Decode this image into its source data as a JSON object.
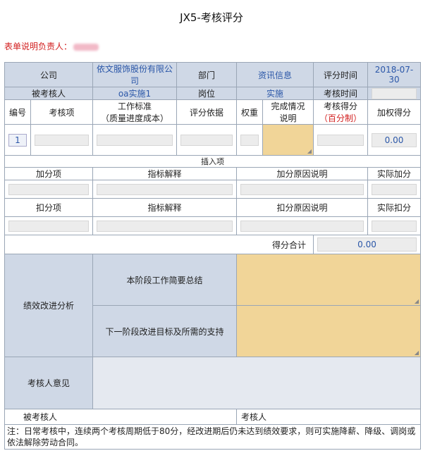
{
  "page": {
    "title": "JX5-考核评分",
    "responsible_label": "表单说明负责人："
  },
  "info": {
    "company_label": "公司",
    "company_value": "依文服饰股份有限公司",
    "dept_label": "部门",
    "dept_value": "资讯信息",
    "score_time_label": "评分时间",
    "score_time_value": "2018-07-30",
    "assessee_label": "被考核人",
    "assessee_value": "oa实施1",
    "post_label": "岗位",
    "post_value": "实施",
    "assess_time_label": "考核时间",
    "assess_time_value": ""
  },
  "items": {
    "headers": {
      "no": "编号",
      "item": "考核项",
      "std_line1": "工作标准",
      "std_line2": "（质量进度成本）",
      "basis": "评分依据",
      "weight": "权重",
      "status_line1": "完成情况",
      "status_line2": "说明",
      "score_line1": "考核得分",
      "score_line2": "（百分制）",
      "weighted": "加权得分"
    },
    "rows": [
      {
        "no": "1",
        "weighted": "0.00"
      }
    ],
    "insert_label": "插入项"
  },
  "bonus": {
    "headers": [
      "加分项",
      "指标解释",
      "加分原因说明",
      "实际加分"
    ]
  },
  "deduct": {
    "headers": [
      "扣分项",
      "指标解释",
      "扣分原因说明",
      "实际扣分"
    ]
  },
  "total": {
    "label": "得分合计",
    "value": "0.00"
  },
  "analysis": {
    "label": "绩效改进分析",
    "summary_label": "本阶段工作简要总结",
    "next_label": "下一阶段改进目标及所需的支持"
  },
  "opinion": {
    "label": "考核人意见"
  },
  "sign": {
    "assessee_label": "被考核人",
    "assessor_label": "考核人"
  },
  "note": "注：日常考核中，连续两个考核周期低于80分，经改进期后仍未达到绩效要求，则可实施降薪、降级、调岗或依法解除劳动合同。"
}
